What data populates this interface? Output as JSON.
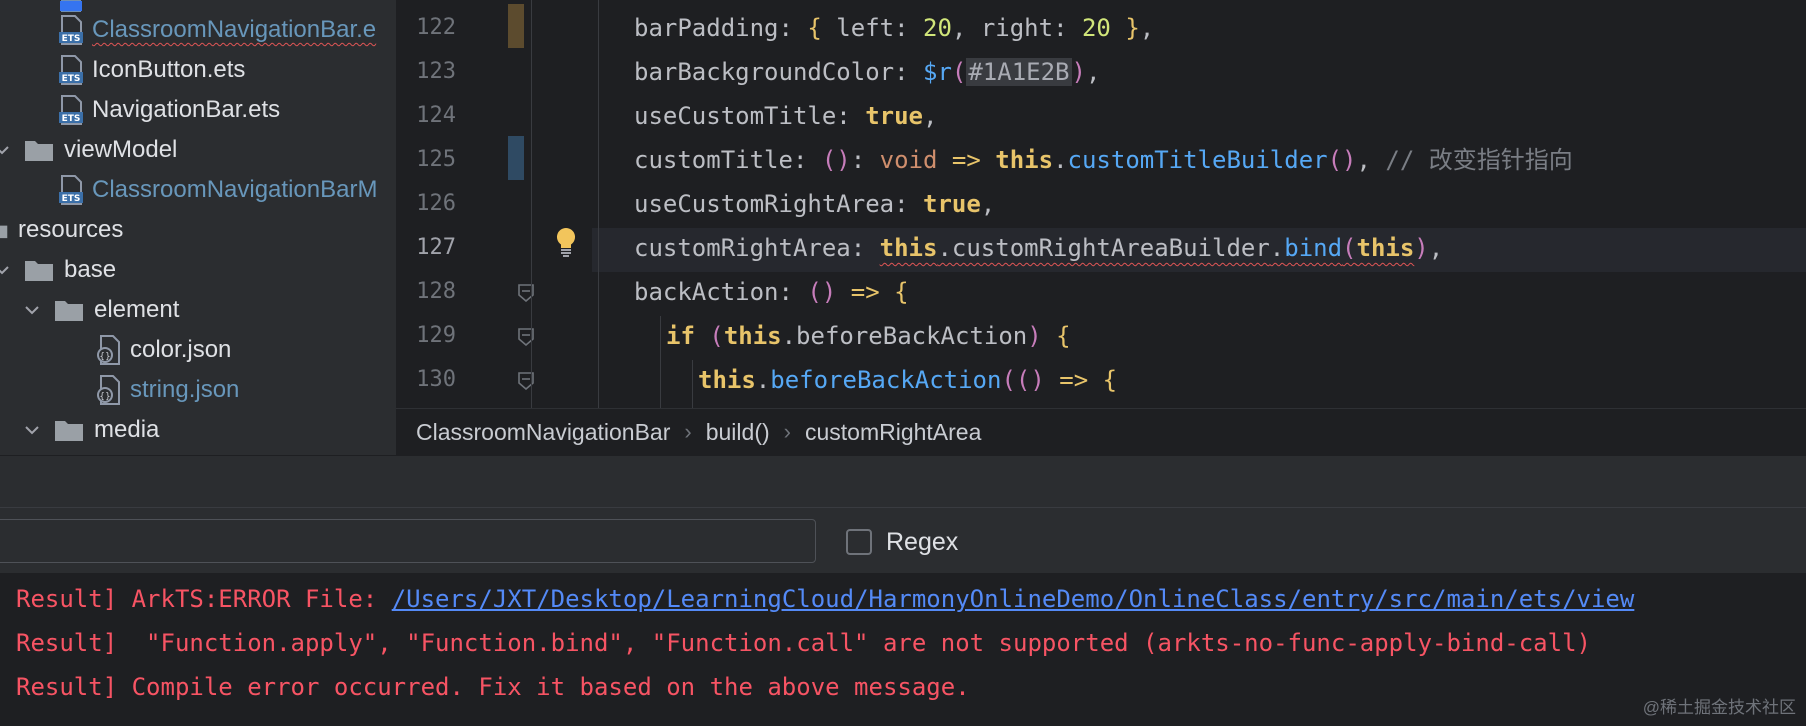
{
  "tree": {
    "items": [
      {
        "label": "ClassroomNavigationBar.e",
        "icon": "ets-file-icon",
        "state": "error"
      },
      {
        "label": "IconButton.ets",
        "icon": "ets-file-icon",
        "state": "normal"
      },
      {
        "label": "NavigationBar.ets",
        "icon": "ets-file-icon",
        "state": "normal"
      },
      {
        "label": "viewModel",
        "icon": "folder-icon",
        "state": "normal"
      },
      {
        "label": "ClassroomNavigationBarM",
        "icon": "ets-file-icon",
        "state": "modified"
      },
      {
        "label": "resources",
        "icon": "folder-icon",
        "state": "normal"
      },
      {
        "label": "base",
        "icon": "folder-icon",
        "state": "normal"
      },
      {
        "label": "element",
        "icon": "folder-icon",
        "state": "normal"
      },
      {
        "label": "color.json",
        "icon": "json-file-icon",
        "state": "normal"
      },
      {
        "label": "string.json",
        "icon": "json-file-icon",
        "state": "modified"
      },
      {
        "label": "media",
        "icon": "folder-icon",
        "state": "normal"
      }
    ]
  },
  "editor": {
    "line_numbers": [
      "122",
      "123",
      "124",
      "125",
      "126",
      "127",
      "128",
      "129",
      "130"
    ],
    "current_line": "127",
    "lines": {
      "l122": {
        "a": "barPadding",
        "b": ": ",
        "c": "{",
        "d": " left: ",
        "e": "20",
        "f": ", right: ",
        "g": "20",
        "h": " }",
        "i": ","
      },
      "l123": {
        "a": "barBackgroundColor",
        "b": ": ",
        "c": "$r",
        "d": "(",
        "e": "#1A1E2B",
        "f": ")",
        "g": ","
      },
      "l124": {
        "a": "useCustomTitle",
        "b": ": ",
        "c": "true",
        "d": ","
      },
      "l125": {
        "a": "customTitle",
        "b": ": ",
        "c": "()",
        "d": ": ",
        "e": "void",
        "f": " => ",
        "g": "this",
        "h": ".",
        "i": "customTitleBuilder",
        "j": "()",
        "k": ", ",
        "l": "// 改变指针指向"
      },
      "l126": {
        "a": "useCustomRightArea",
        "b": ": ",
        "c": "true",
        "d": ","
      },
      "l127": {
        "a": "customRightArea",
        "b": ": ",
        "c": "this",
        "d": ".customRightAreaBuilder",
        "e": ".",
        "f": "bind",
        "g": "(",
        "h": "this",
        "i": ")",
        "j": ","
      },
      "l128": {
        "a": "backAction",
        "b": ": ",
        "c": "()",
        "d": " => ",
        "e": "{"
      },
      "l129": {
        "a": "if",
        "b": " (",
        "c": "this",
        "d": ".beforeBackAction",
        "e": ")",
        "f": " {"
      },
      "l130": {
        "a": "this",
        "b": ".",
        "c": "beforeBackAction",
        "d": "(",
        "e": "()",
        "f": " => ",
        "g": "{"
      }
    }
  },
  "breadcrumb": [
    "ClassroomNavigationBar",
    "build()",
    "customRightArea"
  ],
  "search": {
    "value": "",
    "placeholder": "",
    "regex_label": "Regex",
    "regex_checked": false
  },
  "console": {
    "lines": [
      {
        "prefix": "Result] ArkTS:ERROR File: ",
        "link": "/Users/JXT/Desktop/LearningCloud/HarmonyOnlineDemo/OnlineClass/entry/src/main/ets/view"
      },
      {
        "text": "Result]  \"Function.apply\", \"Function.bind\", \"Function.call\" are not supported (arkts-no-func-apply-bind-call)"
      },
      {
        "text": "Result] Compile error occurred. Fix it based on the above message."
      }
    ]
  },
  "watermark": "@稀土掘金技术社区",
  "colors": {
    "error_text": "#f75464",
    "link": "#548af7",
    "modified_file": "#6897bb",
    "keyword": "#cf8e6d",
    "function": "#56a8f5",
    "background": "#1e1f22"
  }
}
